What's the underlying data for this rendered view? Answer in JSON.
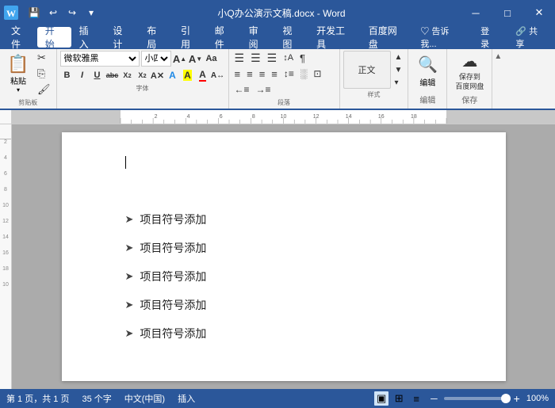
{
  "titlebar": {
    "doc_title": "小Q办公演示文稿.docx - Word",
    "app": "Word",
    "quick_save": "💾",
    "undo": "↩",
    "redo": "↪",
    "customize": "▾",
    "minimize": "─",
    "restore": "□",
    "close": "✕"
  },
  "menubar": {
    "items": [
      "文件",
      "开始",
      "插入",
      "设计",
      "布局",
      "引用",
      "邮件",
      "审阅",
      "视图",
      "开发工具",
      "百度网盘"
    ],
    "active": "开始",
    "right_items": [
      "♡ 告诉我...",
      "登录",
      "♡ 共享"
    ]
  },
  "ribbon": {
    "clipboard": {
      "label": "剪贴板",
      "paste": "粘贴",
      "cut": "✂",
      "copy": "⎘",
      "format_painter": "🖌"
    },
    "font": {
      "label": "字体",
      "name": "微软雅黑",
      "size": "小四",
      "bold": "B",
      "italic": "I",
      "underline": "U",
      "strikethrough": "abc",
      "sub": "X₂",
      "sup": "X²",
      "clear": "A",
      "text_color": "A",
      "highlight": "A",
      "font_color": "A",
      "grow": "A↑",
      "shrink": "A↓",
      "change_case": "Aa",
      "char_spacing": "A↔"
    },
    "paragraph": {
      "label": "段落",
      "bullets": "☰",
      "numbering": "☰",
      "outline": "☰",
      "sort": "↕A",
      "show_marks": "¶",
      "align_left": "≡",
      "align_center": "≡",
      "align_right": "≡",
      "justify": "≡",
      "line_spacing": "↕",
      "shading": "░",
      "border": "⊡",
      "indent_left": "←",
      "indent_right": "→"
    },
    "styles": {
      "label": "样式",
      "name": "样式"
    },
    "editing": {
      "label": "编辑",
      "name": "编辑"
    },
    "save": {
      "label": "保存",
      "name": "保存到\n百度网盘"
    }
  },
  "document": {
    "bullet_items": [
      "项目符号添加",
      "项目符号添加",
      "项目符号添加",
      "项目符号添加",
      "项目符号添加"
    ],
    "bullet_arrow": "➤"
  },
  "statusbar": {
    "page_info": "第 1 页，共 1 页",
    "char_count": "35 个字",
    "language": "中文(中国)",
    "insert_mode": "插入",
    "zoom": "100%",
    "zoom_minus": "─",
    "zoom_plus": "+"
  }
}
